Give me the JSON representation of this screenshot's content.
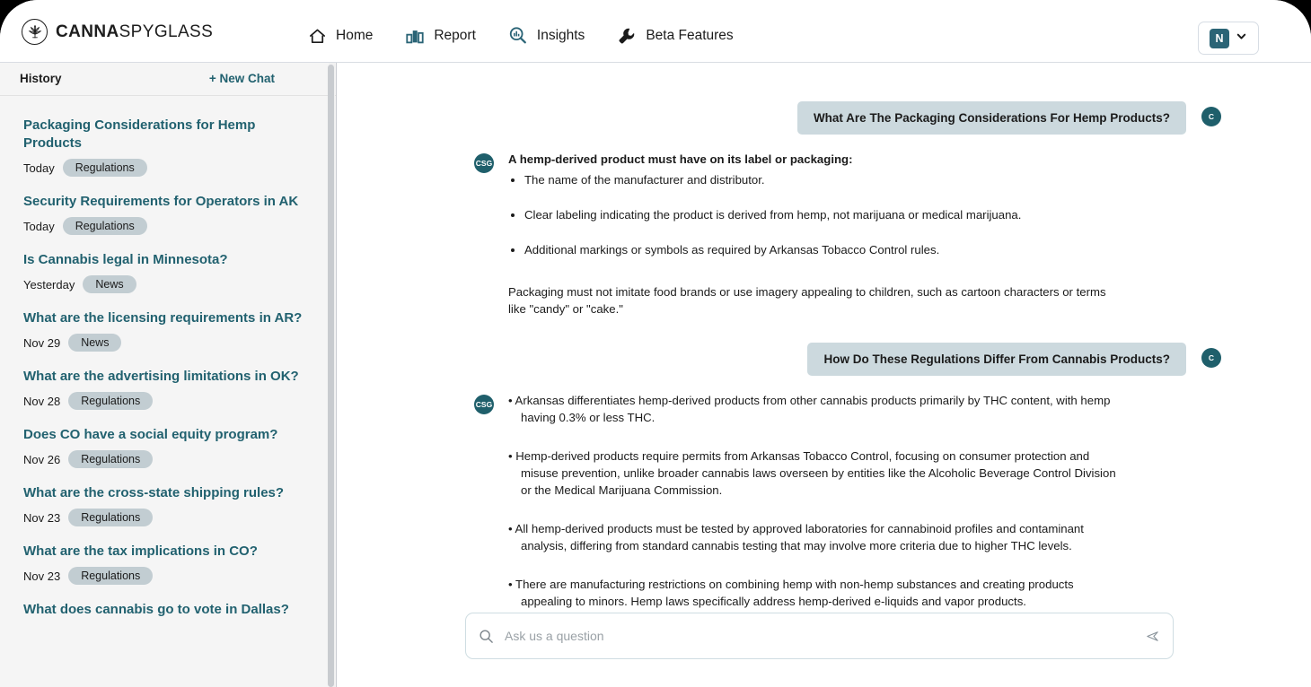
{
  "brand": {
    "name_bold": "CANNA",
    "name_light": "SPYGLASS",
    "logo_icon": "cannabis-leaf-circle-icon"
  },
  "nav": {
    "items": [
      {
        "label": "Home",
        "icon": "home-icon"
      },
      {
        "label": "Report",
        "icon": "bar-chart-icon"
      },
      {
        "label": "Insights",
        "icon": "magnifier-chart-icon"
      },
      {
        "label": "Beta Features",
        "icon": "wrench-icon"
      }
    ]
  },
  "user": {
    "initial": "N",
    "chevron": "chevron-down-icon"
  },
  "sidebar": {
    "title": "History",
    "new_chat_label": "+ New Chat",
    "items": [
      {
        "title": "Packaging Considerations for Hemp Products",
        "date": "Today",
        "tag": "Regulations"
      },
      {
        "title": "Security Requirements for Operators in AK",
        "date": "Today",
        "tag": "Regulations"
      },
      {
        "title": "Is Cannabis legal in Minnesota?",
        "date": "Yesterday",
        "tag": "News"
      },
      {
        "title": "What are the licensing requirements in AR?",
        "date": "Nov 29",
        "tag": "News"
      },
      {
        "title": "What are the advertising limitations in OK?",
        "date": "Nov 28",
        "tag": "Regulations"
      },
      {
        "title": "Does CO have a social equity program?",
        "date": "Nov 26",
        "tag": "Regulations"
      },
      {
        "title": "What are the cross-state shipping rules?",
        "date": "Nov 23",
        "tag": "Regulations"
      },
      {
        "title": "What are the tax implications in CO?",
        "date": "Nov 23",
        "tag": "Regulations"
      },
      {
        "title": "What does cannabis go to vote in Dallas?",
        "date": "",
        "tag": ""
      }
    ]
  },
  "chat": {
    "user_avatar_label": "C",
    "bot_avatar_label": "CSG",
    "messages": [
      {
        "role": "user",
        "text": "What Are The Packaging Considerations For Hemp Products?"
      },
      {
        "role": "bot",
        "lead": "A hemp-derived product must have on its label or packaging:",
        "bullets": [
          "The name of the manufacturer and distributor.",
          "Clear labeling indicating the product is derived from hemp, not marijuana or medical marijuana.",
          "Additional markings or symbols as required by Arkansas Tobacco Control rules."
        ],
        "paragraph": "Packaging must not imitate food brands or use imagery appealing to children, such as cartoon characters or terms like \"candy\" or \"cake.\""
      },
      {
        "role": "user",
        "text": "How Do These Regulations Differ From Cannabis Products?"
      },
      {
        "role": "bot",
        "bullets": [
          "•  Arkansas differentiates hemp-derived products from other cannabis products primarily by THC content, with hemp having 0.3% or less THC.",
          "•  Hemp-derived products require permits from Arkansas Tobacco Control, focusing on consumer protection and misuse prevention, unlike broader cannabis laws overseen by entities like the Alcoholic Beverage Control Division or the Medical Marijuana Commission.",
          "•  All hemp-derived products must be tested by approved laboratories for cannabinoid profiles and contaminant analysis, differing from standard cannabis testing that may involve more criteria due to higher THC levels.",
          "•  There are manufacturing restrictions on combining hemp with non-hemp substances and creating products appealing to minors. Hemp laws specifically address hemp-derived e-liquids and vapor products."
        ]
      }
    ]
  },
  "composer": {
    "placeholder": "Ask us a question",
    "value": "",
    "search_icon": "search-icon",
    "send_icon": "send-paper-plane-icon"
  },
  "colors": {
    "brand_teal": "#21616f",
    "avatar_teal": "#1f5f6b",
    "user_bubble": "#ccd9de",
    "tag_gray": "#c2cdd2",
    "sidebar_bg": "#f5f5f5"
  }
}
